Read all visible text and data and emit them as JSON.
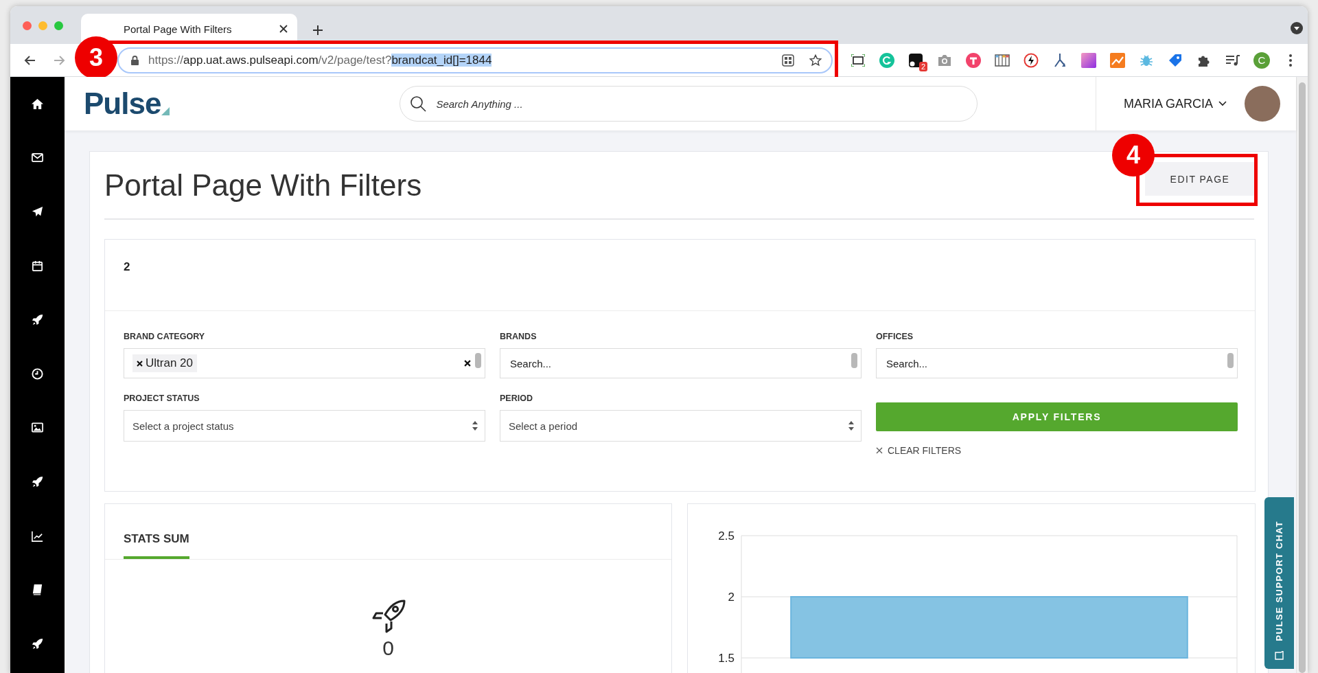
{
  "browser": {
    "tab_title": "Portal Page With Filters",
    "address": [
      {
        "text": "https://",
        "kind": "muted"
      },
      {
        "text": "app.uat.aws.pulseapi.com",
        "kind": "host"
      },
      {
        "text": "/v2/page/test?",
        "kind": "muted"
      },
      {
        "text": "brandcat_id[]=1844",
        "kind": "selection"
      }
    ],
    "extension_badge": "2",
    "profile_initial": "C"
  },
  "header": {
    "logo": "Pulse",
    "search": {
      "placeholder": "Search Anything ..."
    },
    "user": "MARIA GARCIA"
  },
  "page": {
    "title": "Portal Page With Filters",
    "edit_button": "EDIT PAGE"
  },
  "widget": {
    "value": "2",
    "filters": [
      {
        "label": "BRAND CATEGORY",
        "kind": "tags",
        "tags": [
          "Ultran 20"
        ]
      },
      {
        "label": "BRANDS",
        "kind": "search",
        "placeholder": "Search..."
      },
      {
        "label": "OFFICES",
        "kind": "search",
        "placeholder": "Search..."
      },
      {
        "label": "PROJECT STATUS",
        "kind": "select",
        "placeholder": "Select a project status"
      },
      {
        "label": "PERIOD",
        "kind": "select",
        "placeholder": "Select a period"
      }
    ],
    "apply_button": "APPLY FILTERS",
    "clear_filters": "CLEAR FILTERS"
  },
  "stats": {
    "tabs": [
      {
        "label": "STATS SUM",
        "selected": true
      }
    ],
    "value": "0"
  },
  "chart": {
    "chart_data": {
      "type": "bar",
      "values": [
        2
      ],
      "yticks": [
        1.5,
        2,
        2.5
      ],
      "ylim": [
        1.5,
        2.5
      ]
    }
  },
  "support_chat": "PULSE SUPPORT CHAT",
  "annotations": [
    {
      "number": "3"
    },
    {
      "number": "4"
    }
  ]
}
